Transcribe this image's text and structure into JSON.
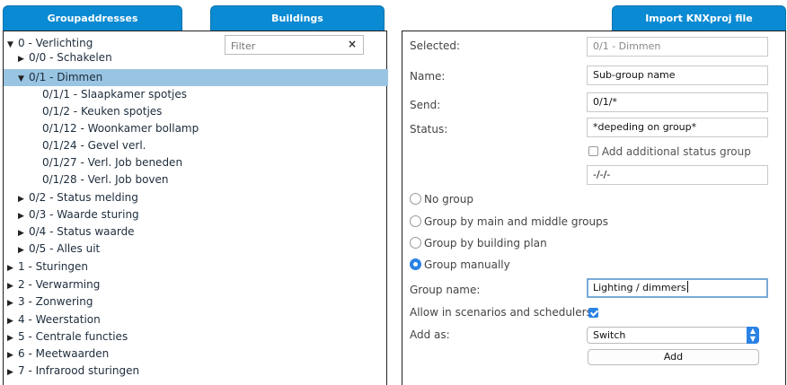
{
  "tabs": {
    "groupaddresses": "Groupaddresses",
    "buildings": "Buildings",
    "import": "Import KNXproj file"
  },
  "filter": {
    "placeholder": "Filter",
    "clear_icon": "×"
  },
  "tree": [
    {
      "label": "0 - Verlichting",
      "level": 0,
      "expanded": true,
      "selected": false
    },
    {
      "label": "0/0 - Schakelen",
      "level": 1,
      "expanded": false,
      "selected": false
    },
    {
      "label": "0/1 - Dimmen",
      "level": 1,
      "expanded": true,
      "selected": true
    },
    {
      "label": "0/1/1 - Slaapkamer spotjes",
      "level": 2,
      "leaf": true
    },
    {
      "label": "0/1/2 - Keuken spotjes",
      "level": 2,
      "leaf": true
    },
    {
      "label": "0/1/12 - Woonkamer bollamp",
      "level": 2,
      "leaf": true
    },
    {
      "label": "0/1/24 - Gevel verl.",
      "level": 2,
      "leaf": true
    },
    {
      "label": "0/1/27 - Verl. Job beneden",
      "level": 2,
      "leaf": true
    },
    {
      "label": "0/1/28 - Verl. Job boven",
      "level": 2,
      "leaf": true
    },
    {
      "label": "0/2 - Status melding",
      "level": 1,
      "expanded": false
    },
    {
      "label": "0/3 - Waarde sturing",
      "level": 1,
      "expanded": false
    },
    {
      "label": "0/4 - Status waarde",
      "level": 1,
      "expanded": false
    },
    {
      "label": "0/5 - Alles uit",
      "level": 1,
      "expanded": false
    },
    {
      "label": "1 - Sturingen",
      "level": 0,
      "expanded": false
    },
    {
      "label": "2 - Verwarming",
      "level": 0,
      "expanded": false
    },
    {
      "label": "3 - Zonwering",
      "level": 0,
      "expanded": false
    },
    {
      "label": "4 - Weerstation",
      "level": 0,
      "expanded": false
    },
    {
      "label": "5 - Centrale functies",
      "level": 0,
      "expanded": false
    },
    {
      "label": "6 - Meetwaarden",
      "level": 0,
      "expanded": false
    },
    {
      "label": "7 - Infrarood sturingen",
      "level": 0,
      "expanded": false
    }
  ],
  "form": {
    "selected_label": "Selected:",
    "selected_value": "0/1 - Dimmen",
    "name_label": "Name:",
    "name_value": "Sub-group name",
    "send_label": "Send:",
    "send_value": "0/1/*",
    "status_label": "Status:",
    "status_value": "*depeding on group*",
    "additional_status_label": "Add additional status group",
    "additional_status_value": "-/-/-",
    "radio_options": [
      {
        "label": "No group",
        "selected": false
      },
      {
        "label": "Group by main and middle groups",
        "selected": false
      },
      {
        "label": "Group by building plan",
        "selected": false
      },
      {
        "label": "Group manually",
        "selected": true
      }
    ],
    "group_name_label": "Group name:",
    "group_name_value": "Lighting / dimmers",
    "allow_label": "Allow in scenarios and schedulers:",
    "allow_checked": true,
    "add_as_label": "Add as:",
    "add_as_value": "Switch",
    "add_button": "Add"
  },
  "colors": {
    "tab_blue": "#0a8ad2",
    "selection": "#99c4e2",
    "accent": "#2a82e4"
  }
}
